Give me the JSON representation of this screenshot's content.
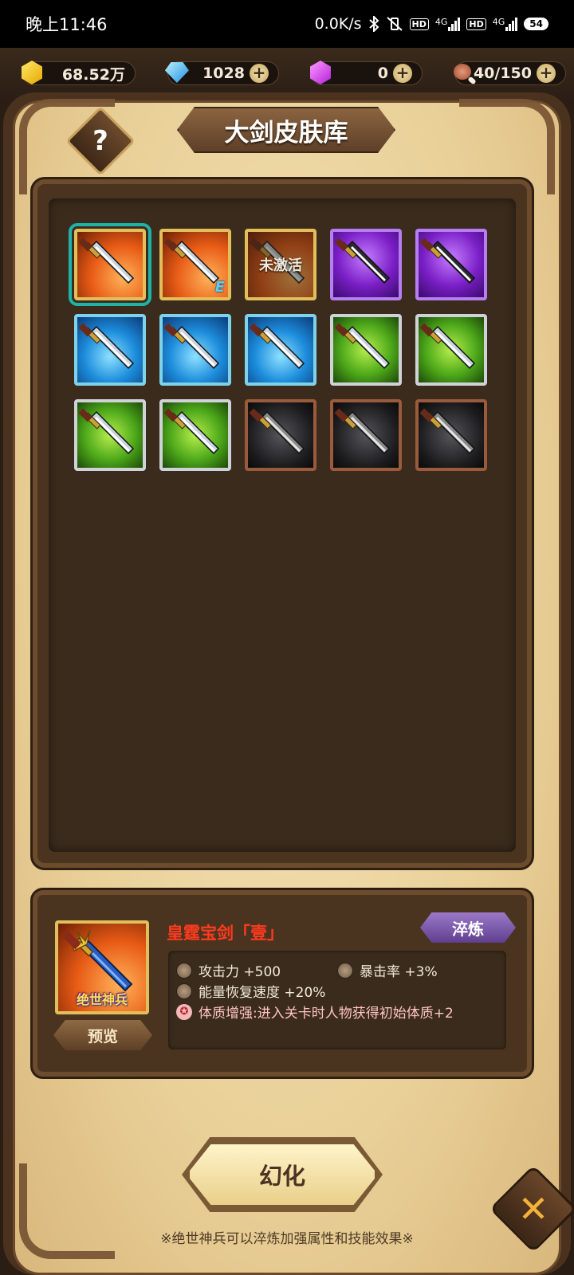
{
  "status_bar": {
    "time": "晚上11:46",
    "network_speed": "0.0K/s",
    "hd1": "HD",
    "net1": "4G",
    "hd2": "HD",
    "net2": "4G",
    "battery": "54"
  },
  "resources": {
    "gold": "68.52万",
    "diamond": "1028",
    "crystal": "0",
    "stamina": "40/150"
  },
  "title": "大剑皮肤库",
  "help_label": "?",
  "skins": [
    {
      "bg": "orange",
      "border": "gold",
      "selected": true,
      "locked": false
    },
    {
      "bg": "orange",
      "border": "gold",
      "selected": false,
      "locked": false,
      "mark": "E"
    },
    {
      "bg": "orange",
      "border": "gold",
      "selected": false,
      "locked": true,
      "lock_text": "未激活"
    },
    {
      "bg": "purple",
      "border": "purple",
      "selected": false,
      "locked": false
    },
    {
      "bg": "purple",
      "border": "purple",
      "selected": false,
      "locked": false
    },
    {
      "bg": "blue",
      "border": "teal",
      "selected": false,
      "locked": false
    },
    {
      "bg": "blue",
      "border": "teal",
      "selected": false,
      "locked": false
    },
    {
      "bg": "blue",
      "border": "teal",
      "selected": false,
      "locked": false
    },
    {
      "bg": "green",
      "border": "silver",
      "selected": false,
      "locked": false
    },
    {
      "bg": "green",
      "border": "silver",
      "selected": false,
      "locked": false
    },
    {
      "bg": "green",
      "border": "silver",
      "selected": false,
      "locked": false
    },
    {
      "bg": "green",
      "border": "silver",
      "selected": false,
      "locked": false
    },
    {
      "bg": "dark",
      "border": "copper",
      "selected": false,
      "locked": false
    },
    {
      "bg": "dark",
      "border": "copper",
      "selected": false,
      "locked": false
    },
    {
      "bg": "dark",
      "border": "copper",
      "selected": false,
      "locked": false
    }
  ],
  "detail": {
    "badge": "绝世神兵",
    "preview_label": "预览",
    "name": "皇霆宝剑「壹」",
    "refine_label": "淬炼",
    "stat_attack": "攻击力 +500",
    "stat_crit": "暴击率 +3%",
    "stat_energy": "能量恢复速度 +20%",
    "stat_special": "体质增强:进入关卡时人物获得初始体质+2"
  },
  "transform_label": "幻化",
  "footnote": "※绝世神兵可以淬炼加强属性和技能效果※",
  "close_label": "✕",
  "colors": {
    "accent_red": "#ff3a1f",
    "selected_outline": "#1fb3a8",
    "refine_purple": "#7a56b0",
    "parchment": "#efdcae"
  }
}
